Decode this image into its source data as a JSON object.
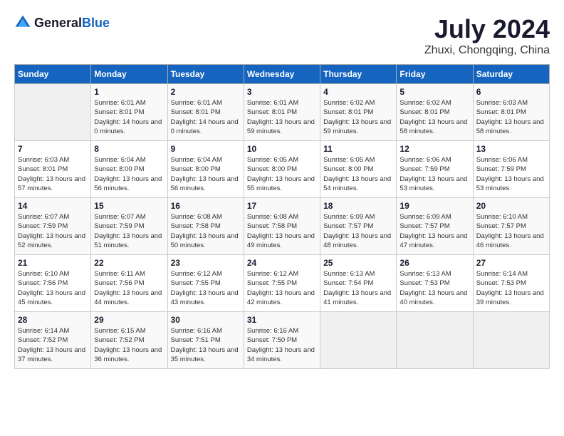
{
  "logo": {
    "text_general": "General",
    "text_blue": "Blue"
  },
  "title": {
    "month_year": "July 2024",
    "location": "Zhuxi, Chongqing, China"
  },
  "headers": [
    "Sunday",
    "Monday",
    "Tuesday",
    "Wednesday",
    "Thursday",
    "Friday",
    "Saturday"
  ],
  "weeks": [
    [
      {
        "day": "",
        "sunrise": "",
        "sunset": "",
        "daylight": "",
        "empty": true
      },
      {
        "day": "1",
        "sunrise": "Sunrise: 6:01 AM",
        "sunset": "Sunset: 8:01 PM",
        "daylight": "Daylight: 14 hours and 0 minutes."
      },
      {
        "day": "2",
        "sunrise": "Sunrise: 6:01 AM",
        "sunset": "Sunset: 8:01 PM",
        "daylight": "Daylight: 14 hours and 0 minutes."
      },
      {
        "day": "3",
        "sunrise": "Sunrise: 6:01 AM",
        "sunset": "Sunset: 8:01 PM",
        "daylight": "Daylight: 13 hours and 59 minutes."
      },
      {
        "day": "4",
        "sunrise": "Sunrise: 6:02 AM",
        "sunset": "Sunset: 8:01 PM",
        "daylight": "Daylight: 13 hours and 59 minutes."
      },
      {
        "day": "5",
        "sunrise": "Sunrise: 6:02 AM",
        "sunset": "Sunset: 8:01 PM",
        "daylight": "Daylight: 13 hours and 58 minutes."
      },
      {
        "day": "6",
        "sunrise": "Sunrise: 6:03 AM",
        "sunset": "Sunset: 8:01 PM",
        "daylight": "Daylight: 13 hours and 58 minutes."
      }
    ],
    [
      {
        "day": "7",
        "sunrise": "Sunrise: 6:03 AM",
        "sunset": "Sunset: 8:01 PM",
        "daylight": "Daylight: 13 hours and 57 minutes."
      },
      {
        "day": "8",
        "sunrise": "Sunrise: 6:04 AM",
        "sunset": "Sunset: 8:00 PM",
        "daylight": "Daylight: 13 hours and 56 minutes."
      },
      {
        "day": "9",
        "sunrise": "Sunrise: 6:04 AM",
        "sunset": "Sunset: 8:00 PM",
        "daylight": "Daylight: 13 hours and 56 minutes."
      },
      {
        "day": "10",
        "sunrise": "Sunrise: 6:05 AM",
        "sunset": "Sunset: 8:00 PM",
        "daylight": "Daylight: 13 hours and 55 minutes."
      },
      {
        "day": "11",
        "sunrise": "Sunrise: 6:05 AM",
        "sunset": "Sunset: 8:00 PM",
        "daylight": "Daylight: 13 hours and 54 minutes."
      },
      {
        "day": "12",
        "sunrise": "Sunrise: 6:06 AM",
        "sunset": "Sunset: 7:59 PM",
        "daylight": "Daylight: 13 hours and 53 minutes."
      },
      {
        "day": "13",
        "sunrise": "Sunrise: 6:06 AM",
        "sunset": "Sunset: 7:59 PM",
        "daylight": "Daylight: 13 hours and 53 minutes."
      }
    ],
    [
      {
        "day": "14",
        "sunrise": "Sunrise: 6:07 AM",
        "sunset": "Sunset: 7:59 PM",
        "daylight": "Daylight: 13 hours and 52 minutes."
      },
      {
        "day": "15",
        "sunrise": "Sunrise: 6:07 AM",
        "sunset": "Sunset: 7:59 PM",
        "daylight": "Daylight: 13 hours and 51 minutes."
      },
      {
        "day": "16",
        "sunrise": "Sunrise: 6:08 AM",
        "sunset": "Sunset: 7:58 PM",
        "daylight": "Daylight: 13 hours and 50 minutes."
      },
      {
        "day": "17",
        "sunrise": "Sunrise: 6:08 AM",
        "sunset": "Sunset: 7:58 PM",
        "daylight": "Daylight: 13 hours and 49 minutes."
      },
      {
        "day": "18",
        "sunrise": "Sunrise: 6:09 AM",
        "sunset": "Sunset: 7:57 PM",
        "daylight": "Daylight: 13 hours and 48 minutes."
      },
      {
        "day": "19",
        "sunrise": "Sunrise: 6:09 AM",
        "sunset": "Sunset: 7:57 PM",
        "daylight": "Daylight: 13 hours and 47 minutes."
      },
      {
        "day": "20",
        "sunrise": "Sunrise: 6:10 AM",
        "sunset": "Sunset: 7:57 PM",
        "daylight": "Daylight: 13 hours and 46 minutes."
      }
    ],
    [
      {
        "day": "21",
        "sunrise": "Sunrise: 6:10 AM",
        "sunset": "Sunset: 7:56 PM",
        "daylight": "Daylight: 13 hours and 45 minutes."
      },
      {
        "day": "22",
        "sunrise": "Sunrise: 6:11 AM",
        "sunset": "Sunset: 7:56 PM",
        "daylight": "Daylight: 13 hours and 44 minutes."
      },
      {
        "day": "23",
        "sunrise": "Sunrise: 6:12 AM",
        "sunset": "Sunset: 7:55 PM",
        "daylight": "Daylight: 13 hours and 43 minutes."
      },
      {
        "day": "24",
        "sunrise": "Sunrise: 6:12 AM",
        "sunset": "Sunset: 7:55 PM",
        "daylight": "Daylight: 13 hours and 42 minutes."
      },
      {
        "day": "25",
        "sunrise": "Sunrise: 6:13 AM",
        "sunset": "Sunset: 7:54 PM",
        "daylight": "Daylight: 13 hours and 41 minutes."
      },
      {
        "day": "26",
        "sunrise": "Sunrise: 6:13 AM",
        "sunset": "Sunset: 7:53 PM",
        "daylight": "Daylight: 13 hours and 40 minutes."
      },
      {
        "day": "27",
        "sunrise": "Sunrise: 6:14 AM",
        "sunset": "Sunset: 7:53 PM",
        "daylight": "Daylight: 13 hours and 39 minutes."
      }
    ],
    [
      {
        "day": "28",
        "sunrise": "Sunrise: 6:14 AM",
        "sunset": "Sunset: 7:52 PM",
        "daylight": "Daylight: 13 hours and 37 minutes."
      },
      {
        "day": "29",
        "sunrise": "Sunrise: 6:15 AM",
        "sunset": "Sunset: 7:52 PM",
        "daylight": "Daylight: 13 hours and 36 minutes."
      },
      {
        "day": "30",
        "sunrise": "Sunrise: 6:16 AM",
        "sunset": "Sunset: 7:51 PM",
        "daylight": "Daylight: 13 hours and 35 minutes."
      },
      {
        "day": "31",
        "sunrise": "Sunrise: 6:16 AM",
        "sunset": "Sunset: 7:50 PM",
        "daylight": "Daylight: 13 hours and 34 minutes."
      },
      {
        "day": "",
        "sunrise": "",
        "sunset": "",
        "daylight": "",
        "empty": true
      },
      {
        "day": "",
        "sunrise": "",
        "sunset": "",
        "daylight": "",
        "empty": true
      },
      {
        "day": "",
        "sunrise": "",
        "sunset": "",
        "daylight": "",
        "empty": true
      }
    ]
  ]
}
